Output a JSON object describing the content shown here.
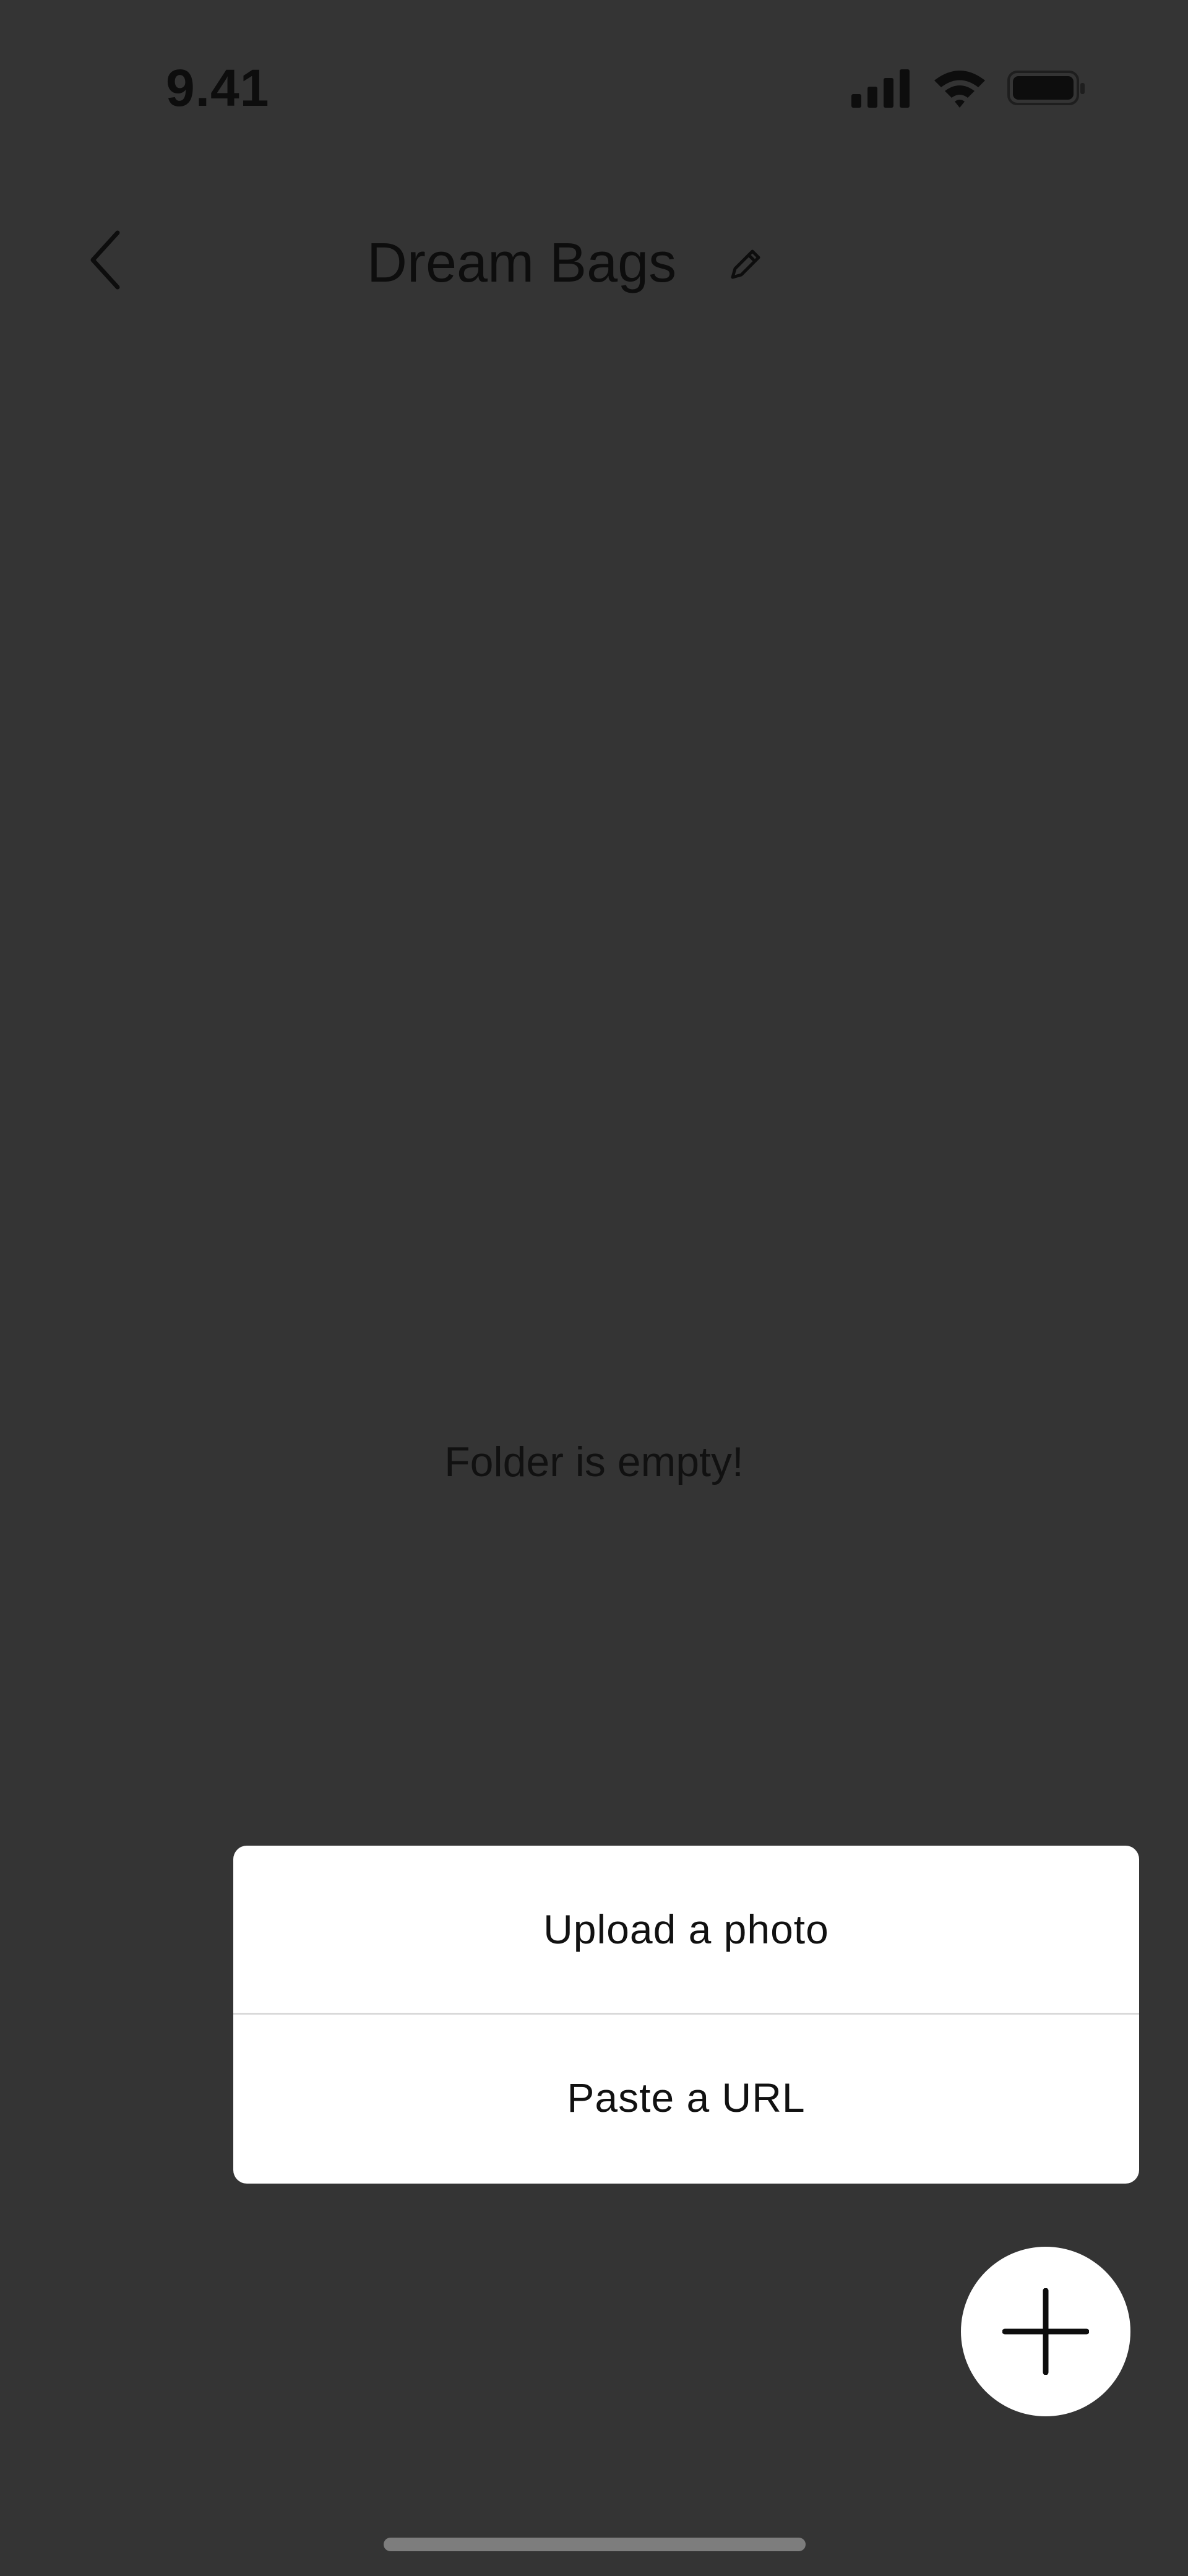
{
  "status_bar": {
    "time": "9.41",
    "icons": [
      "cellular-signal-icon",
      "wifi-icon",
      "battery-icon"
    ]
  },
  "header": {
    "back_icon": "chevron-left-icon",
    "title": "Dream Bags",
    "edit_icon": "pencil-icon"
  },
  "main": {
    "empty_message": "Folder is empty!"
  },
  "add_menu": {
    "items": [
      {
        "label": "Upload a photo"
      },
      {
        "label": "Paste a URL"
      }
    ]
  },
  "fab": {
    "icon": "plus-icon"
  },
  "colors": {
    "background": "#343434",
    "surface": "#ffffff",
    "text": "#111111"
  }
}
